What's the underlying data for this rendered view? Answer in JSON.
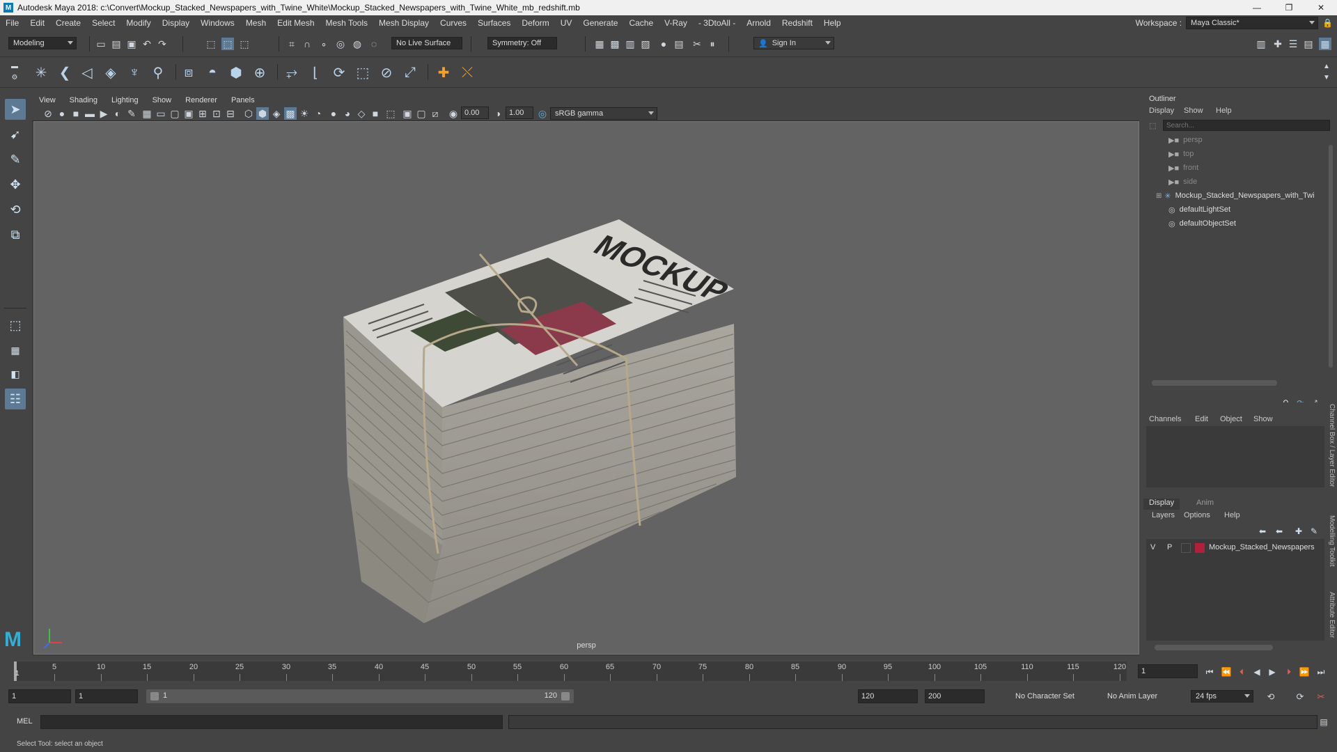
{
  "titlebar": {
    "app_title": "Autodesk Maya 2018: c:\\Convert\\Mockup_Stacked_Newspapers_with_Twine_White\\Mockup_Stacked_Newspapers_with_Twine_White_mb_redshift.mb",
    "logo": "M",
    "minimize": "—",
    "maximize": "❐",
    "close": "✕"
  },
  "menubar": {
    "items": [
      "File",
      "Edit",
      "Create",
      "Select",
      "Modify",
      "Display",
      "Windows",
      "Mesh",
      "Edit Mesh",
      "Mesh Tools",
      "Mesh Display",
      "Curves",
      "Surfaces",
      "Deform",
      "UV",
      "Generate",
      "Cache",
      "V-Ray",
      "- 3DtoAll -",
      "Arnold",
      "Redshift",
      "Help"
    ],
    "workspace_label": "Workspace :",
    "workspace_value": "Maya Classic*"
  },
  "statusline": {
    "mode": "Modeling",
    "live_surface": "No Live Surface",
    "symmetry": "Symmetry: Off",
    "sign_in": "Sign In"
  },
  "viewport": {
    "menu": [
      "View",
      "Shading",
      "Lighting",
      "Show",
      "Renderer",
      "Panels"
    ],
    "exposure": "0.00",
    "gamma": "1.00",
    "color_space": "sRGB gamma",
    "camera": "persp"
  },
  "outliner": {
    "title": "Outliner",
    "menu": [
      "Display",
      "Show",
      "Help"
    ],
    "search_placeholder": "Search...",
    "items": [
      {
        "label": "persp",
        "type": "camera"
      },
      {
        "label": "top",
        "type": "camera"
      },
      {
        "label": "front",
        "type": "camera"
      },
      {
        "label": "side",
        "type": "camera"
      },
      {
        "label": "Mockup_Stacked_Newspapers_with_Twi",
        "type": "group"
      },
      {
        "label": "defaultLightSet",
        "type": "set"
      },
      {
        "label": "defaultObjectSet",
        "type": "set"
      }
    ]
  },
  "channelbox": {
    "menu": [
      "Channels",
      "Edit",
      "Object",
      "Show"
    ]
  },
  "layereditor": {
    "tabs": [
      "Display",
      "Anim"
    ],
    "menu": [
      "Layers",
      "Options",
      "Help"
    ],
    "layer": {
      "v": "V",
      "p": "P",
      "name": "Mockup_Stacked_Newspapers",
      "color": "#b0203a"
    }
  },
  "sidetabs": [
    "Channel Box / Layer Editor",
    "Modelling Toolkit",
    "Attribute Editor"
  ],
  "timeslider": {
    "ticks": [
      5,
      10,
      15,
      20,
      25,
      30,
      35,
      40,
      45,
      50,
      55,
      60,
      65,
      70,
      75,
      80,
      85,
      90,
      95,
      100,
      105,
      110,
      115,
      120
    ],
    "current_frame_marker": "1",
    "current_frame": "1"
  },
  "rangeslider": {
    "start": "1",
    "playback_start": "1",
    "range_start_label": "1",
    "range_end_label": "120",
    "playback_end": "120",
    "end": "200",
    "character_set": "No Character Set",
    "anim_layer": "No Anim Layer",
    "fps": "24 fps"
  },
  "cmdline": {
    "label": "MEL"
  },
  "helpline": {
    "text": "Select Tool: select an object"
  },
  "newspaper": {
    "headline": "MOCKUP"
  }
}
